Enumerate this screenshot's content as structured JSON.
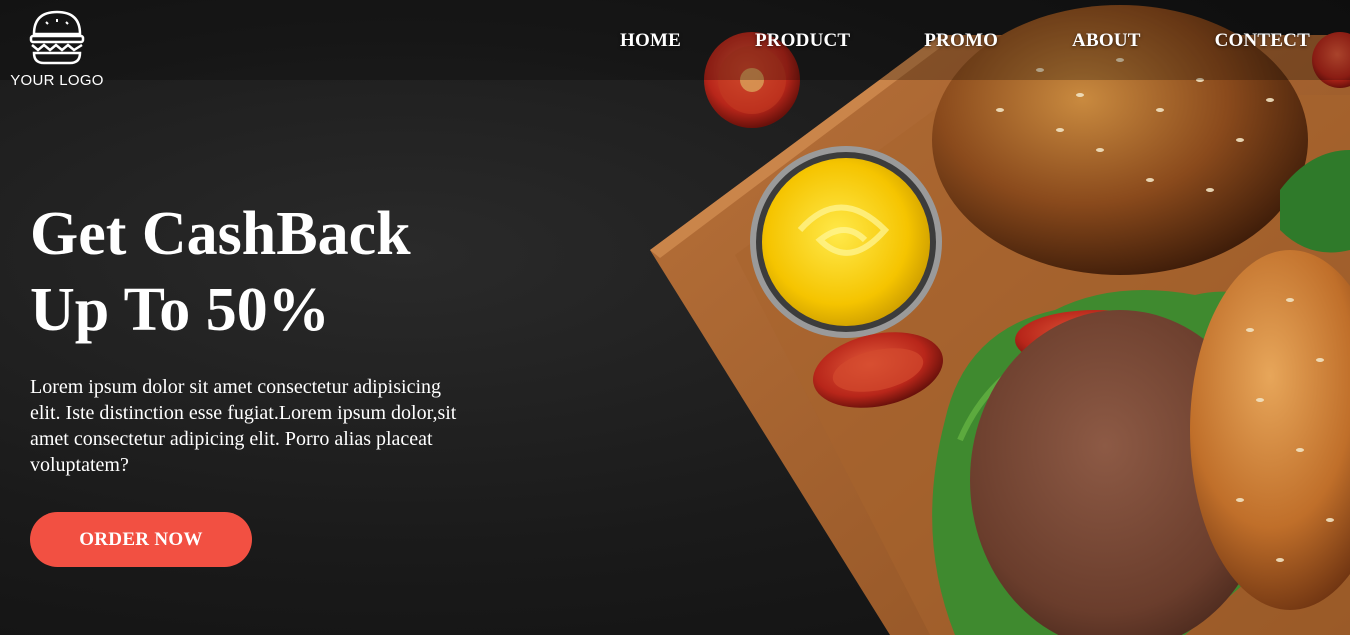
{
  "logo": {
    "text": "YOUR LOGO",
    "icon": "burger-icon"
  },
  "nav": {
    "items": [
      "HOME",
      "PRODUCT",
      "PROMO",
      "ABOUT",
      "CONTECT"
    ]
  },
  "hero": {
    "title_line1": "Get CashBack",
    "title_line2": "Up To 50%",
    "description": "Lorem ipsum dolor sit amet consectetur adipisicing elit. Iste distinction esse fugiat.Lorem ipsum dolor,sit amet consectetur adipicing elit. Porro alias placeat voluptatem?",
    "cta_label": "ORDER NOW"
  },
  "colors": {
    "background": "#1b1b1b",
    "accent": "#f25042",
    "text": "#ffffff"
  }
}
